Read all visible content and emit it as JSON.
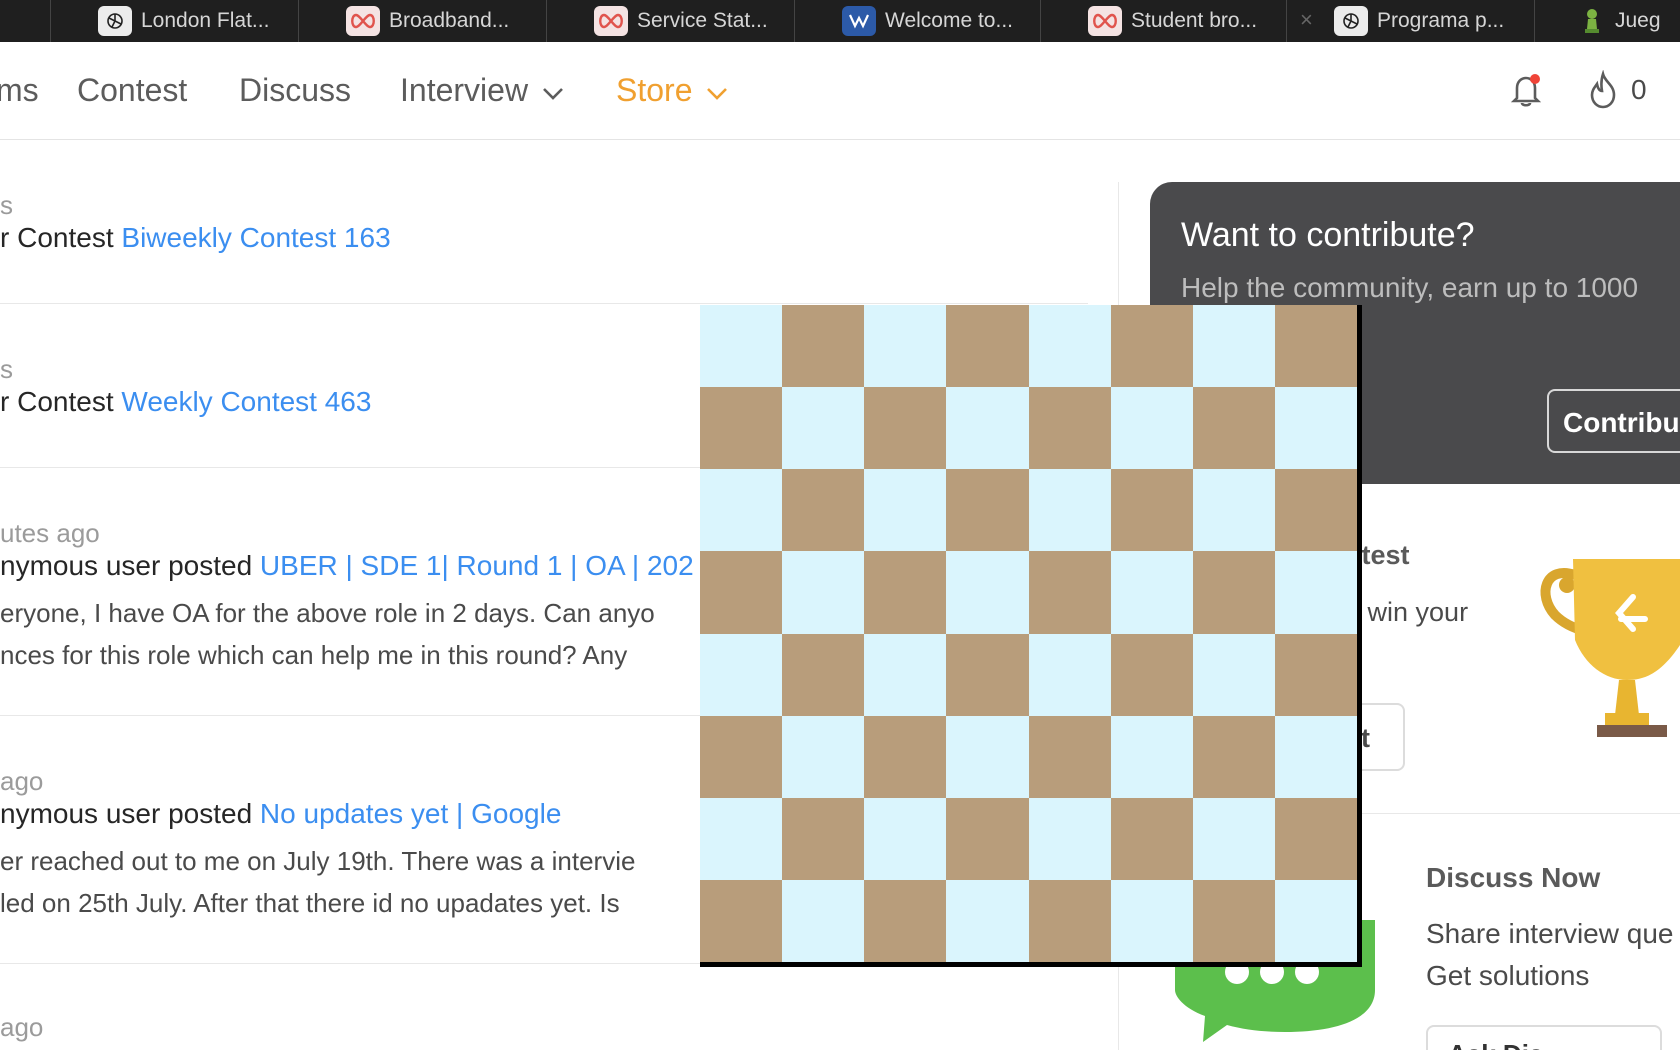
{
  "browser_tabs": [
    {
      "title": "London Flat...",
      "icon": "openai-icon"
    },
    {
      "title": "Broadband...",
      "icon": "infinity-icon"
    },
    {
      "title": "Service Stat...",
      "icon": "infinity-icon"
    },
    {
      "title": "Welcome to...",
      "icon": "welcome-icon"
    },
    {
      "title": "Student bro...",
      "icon": "infinity-icon"
    },
    {
      "title": "Programa p...",
      "icon": "openai-icon"
    },
    {
      "title": "Jueg",
      "icon": "chess-pawn-icon"
    }
  ],
  "nav": {
    "items": [
      "ms",
      "Contest",
      "Discuss",
      "Interview",
      "Store"
    ],
    "notifications": "bell-icon",
    "streak_icon": "flame-icon",
    "streak_count": "0",
    "accent_color": "#f0a030"
  },
  "feed": [
    {
      "meta": "s",
      "prefix": "r Contest ",
      "link": "Biweekly Contest 163",
      "body": []
    },
    {
      "meta": "s",
      "prefix": "r Contest ",
      "link": "Weekly Contest 463",
      "body": []
    },
    {
      "meta": "utes ago",
      "prefix": "nymous user posted ",
      "link": "UBER | SDE 1| Round 1 | OA | 202",
      "body": [
        "eryone, I have OA for the above role in 2 days. Can anyo",
        "nces for this role which can help me in this round? Any"
      ]
    },
    {
      "meta": " ago",
      "prefix": "nymous user posted ",
      "link": "No updates yet | Google",
      "body": [
        "er reached out to me on July 19th. There was a intervie",
        "led on 25th July. After that there id no upadates yet. Is"
      ]
    },
    {
      "meta": " ago",
      "prefix": "",
      "link": "",
      "body": []
    }
  ],
  "sidebar": {
    "contribute": {
      "title": "Want to contribute?",
      "subtitle": "Help the community, earn up to 1000",
      "button": "Contribu"
    },
    "contest": {
      "title": "ntest",
      "text": "d win your",
      "button": "st"
    },
    "discuss": {
      "title": "Discuss Now",
      "lines": [
        "Share interview que",
        "Get solutions"
      ],
      "button": "Ask Dis"
    }
  },
  "board": {
    "light_color": "#daf5fd",
    "dark_color": "#b89d7b",
    "size": 8
  }
}
